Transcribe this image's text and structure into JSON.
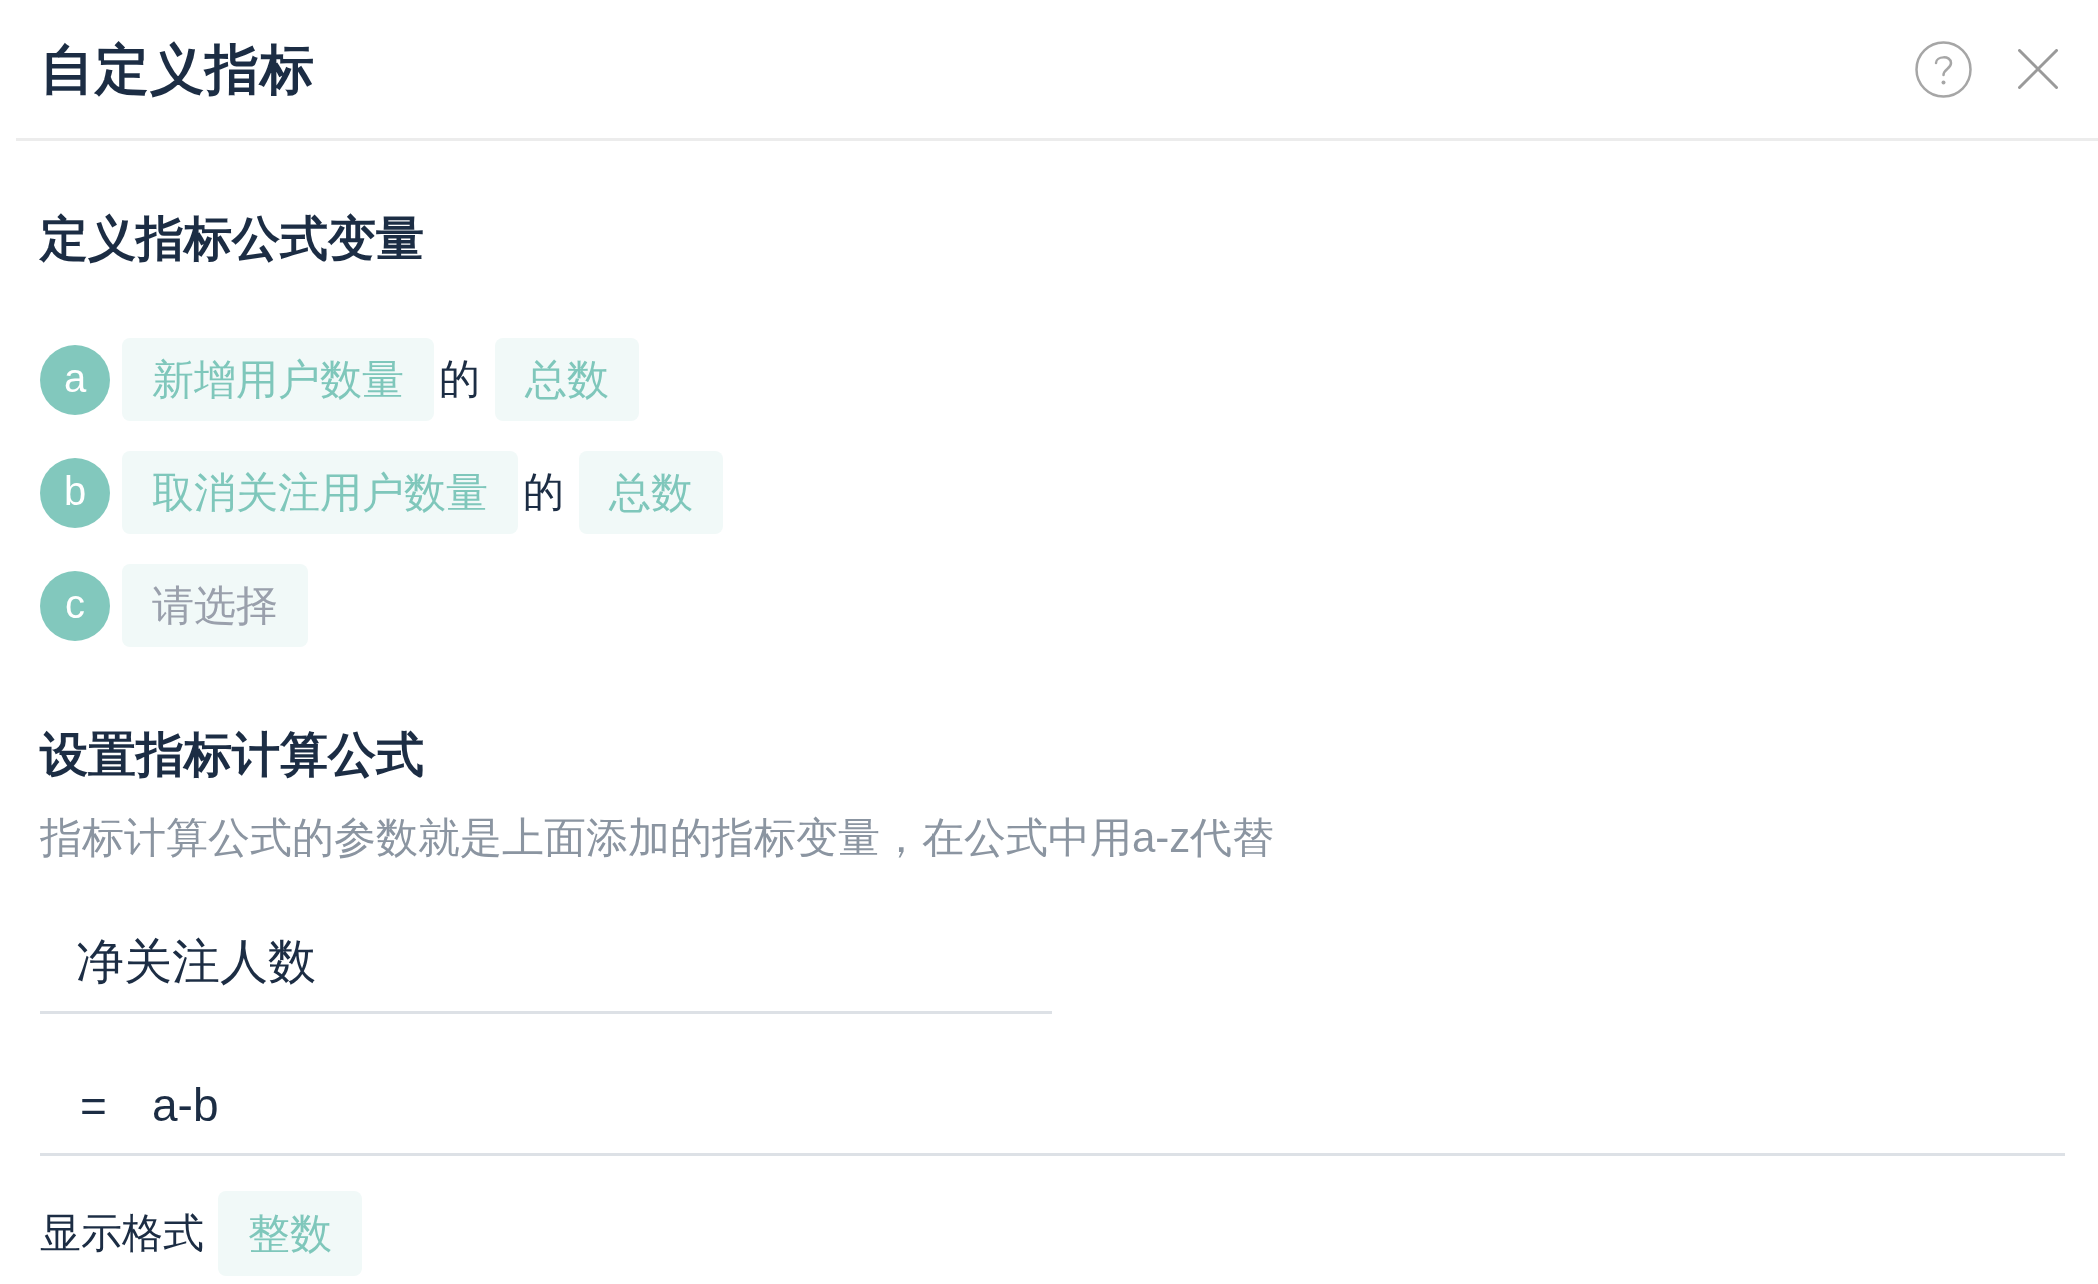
{
  "dialog": {
    "title": "自定义指标"
  },
  "variables_section": {
    "heading": "定义指标公式变量",
    "variables": [
      {
        "letter": "a",
        "metric": "新增用户数量",
        "connector": "的",
        "aggregation": "总数"
      },
      {
        "letter": "b",
        "metric": "取消关注用户数量",
        "connector": "的",
        "aggregation": "总数"
      },
      {
        "letter": "c",
        "placeholder": "请选择"
      }
    ]
  },
  "formula_section": {
    "heading": "设置指标计算公式",
    "description": "指标计算公式的参数就是上面添加的指标变量，在公式中用a-z代替",
    "name_field": {
      "value": "净关注人数"
    },
    "formula_field": {
      "operator": "=",
      "value": "a-b"
    }
  },
  "display_format": {
    "label": "显示格式",
    "value": "整数"
  }
}
